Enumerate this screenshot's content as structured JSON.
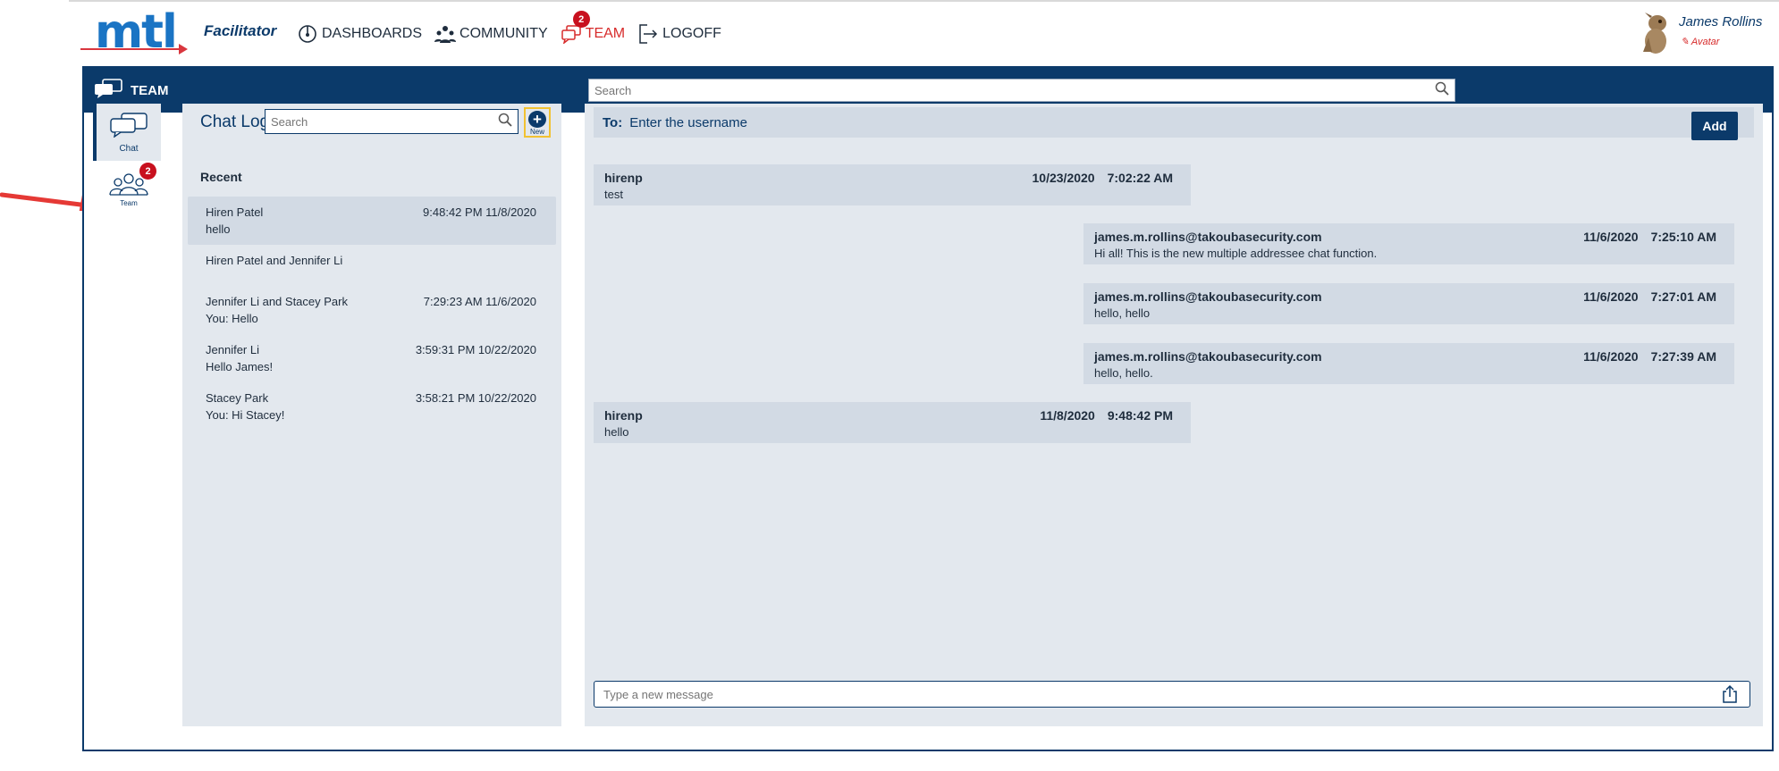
{
  "header": {
    "logo_text": "mtl",
    "role": "Facilitator",
    "nav": [
      {
        "label": "DASHBOARDS",
        "icon": "dashboard-icon"
      },
      {
        "label": "COMMUNITY",
        "icon": "community-icon"
      },
      {
        "label": "TEAM",
        "icon": "team-chat-icon",
        "badge": "2",
        "active": true
      },
      {
        "label": "LOGOFF",
        "icon": "logoff-icon"
      }
    ],
    "user": {
      "name": "James Rollins",
      "avatar_link": "Avatar"
    }
  },
  "bar": {
    "title": "TEAM",
    "search_placeholder": "Search"
  },
  "rail": {
    "chat_label": "Chat",
    "team_label": "Team",
    "team_badge": "2"
  },
  "chat_log": {
    "title": "Chat Log",
    "search_placeholder": "Search",
    "new_label": "New",
    "recent_label": "Recent",
    "items": [
      {
        "name": "Hiren Patel",
        "time": "9:48:42 PM 11/8/2020",
        "message": "hello",
        "selected": true
      },
      {
        "name": "Hiren Patel and Jennifer Li",
        "time": "",
        "message": ""
      },
      {
        "name": "Jennifer Li and Stacey Park",
        "time": "7:29:23 AM 11/6/2020",
        "message": "You: Hello"
      },
      {
        "name": "Jennifer Li",
        "time": "3:59:31 PM 10/22/2020",
        "message": "Hello James!"
      },
      {
        "name": "Stacey Park",
        "time": "3:58:21 PM 10/22/2020",
        "message": "You: Hi Stacey!"
      }
    ]
  },
  "conversation": {
    "to_label": "To:",
    "to_placeholder": "Enter the username",
    "add_label": "Add",
    "messages": [
      {
        "user": "hirenp",
        "date": "10/23/2020",
        "time": "7:02:22 AM",
        "text": "test",
        "side": "in"
      },
      {
        "user": "james.m.rollins@takoubasecurity.com",
        "date": "11/6/2020",
        "time": "7:25:10 AM",
        "text": "Hi all! This is the new multiple addressee chat function.",
        "side": "out"
      },
      {
        "user": "james.m.rollins@takoubasecurity.com",
        "date": "11/6/2020",
        "time": "7:27:01 AM",
        "text": "hello, hello",
        "side": "out"
      },
      {
        "user": "james.m.rollins@takoubasecurity.com",
        "date": "11/6/2020",
        "time": "7:27:39 AM",
        "text": "hello, hello.",
        "side": "out"
      },
      {
        "user": "hirenp",
        "date": "11/8/2020",
        "time": "9:48:42 PM",
        "text": "hello",
        "side": "in"
      }
    ],
    "composer_placeholder": "Type a new message"
  },
  "colors": {
    "brand_navy": "#0b3a6a",
    "brand_blue": "#1a74c4",
    "alert_red": "#c8101e",
    "panel_bg": "#e3e8ee",
    "bubble_bg": "#d2dae4"
  }
}
